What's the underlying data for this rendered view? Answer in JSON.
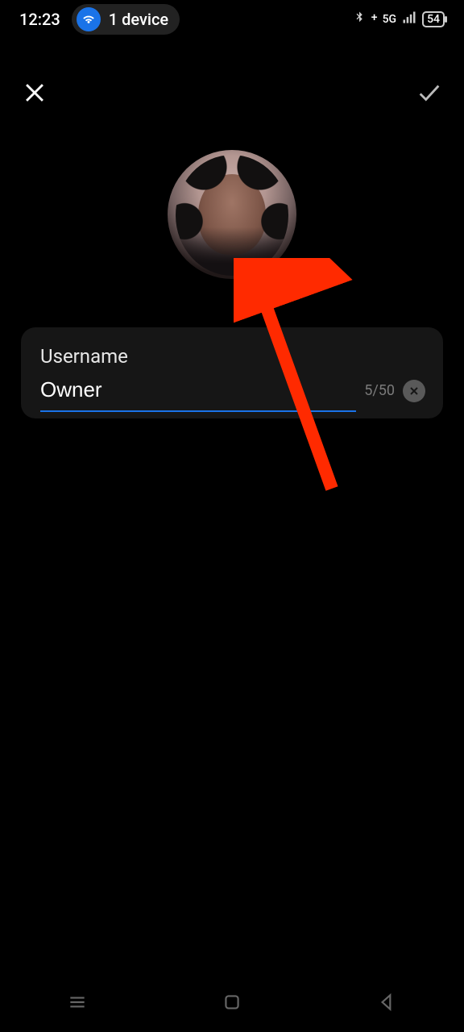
{
  "status": {
    "time": "12:23",
    "device_count": "1 device",
    "network": "5G",
    "battery": "54"
  },
  "form": {
    "label": "Username",
    "value": "Owner",
    "counter": "5/50"
  }
}
